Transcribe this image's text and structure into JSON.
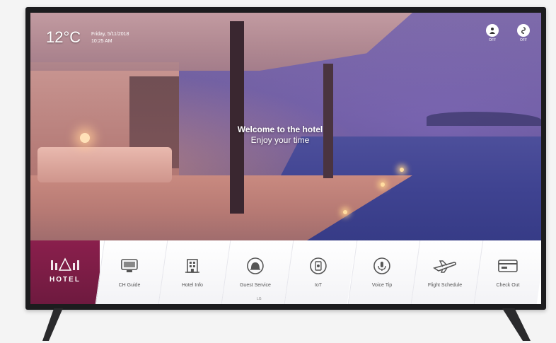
{
  "header": {
    "temperature": "12°C",
    "date": "Friday, 5/11/2018",
    "time": "10:25 AM"
  },
  "status_icons": [
    {
      "name": "person-icon",
      "label": "OFF"
    },
    {
      "name": "dnd-icon",
      "label": "OFF"
    }
  ],
  "welcome": {
    "title": "Welcome to the hotel",
    "subtitle": "Enjoy your time"
  },
  "hotel": {
    "name": "HOTEL"
  },
  "menu": {
    "items": [
      {
        "label": "CH Guide",
        "icon": "tv-icon"
      },
      {
        "label": "Hotel Info",
        "icon": "building-icon"
      },
      {
        "label": "Guest Service",
        "icon": "bell-icon"
      },
      {
        "label": "IoT",
        "icon": "iot-icon"
      },
      {
        "label": "Voice Tip",
        "icon": "voice-icon"
      },
      {
        "label": "Flight Schedule",
        "icon": "airplane-icon"
      },
      {
        "label": "Check Out",
        "icon": "card-icon"
      }
    ]
  },
  "brand": {
    "mark": "LG"
  },
  "colors": {
    "accent": "#7a1c46",
    "menu_bg": "#ffffff"
  }
}
